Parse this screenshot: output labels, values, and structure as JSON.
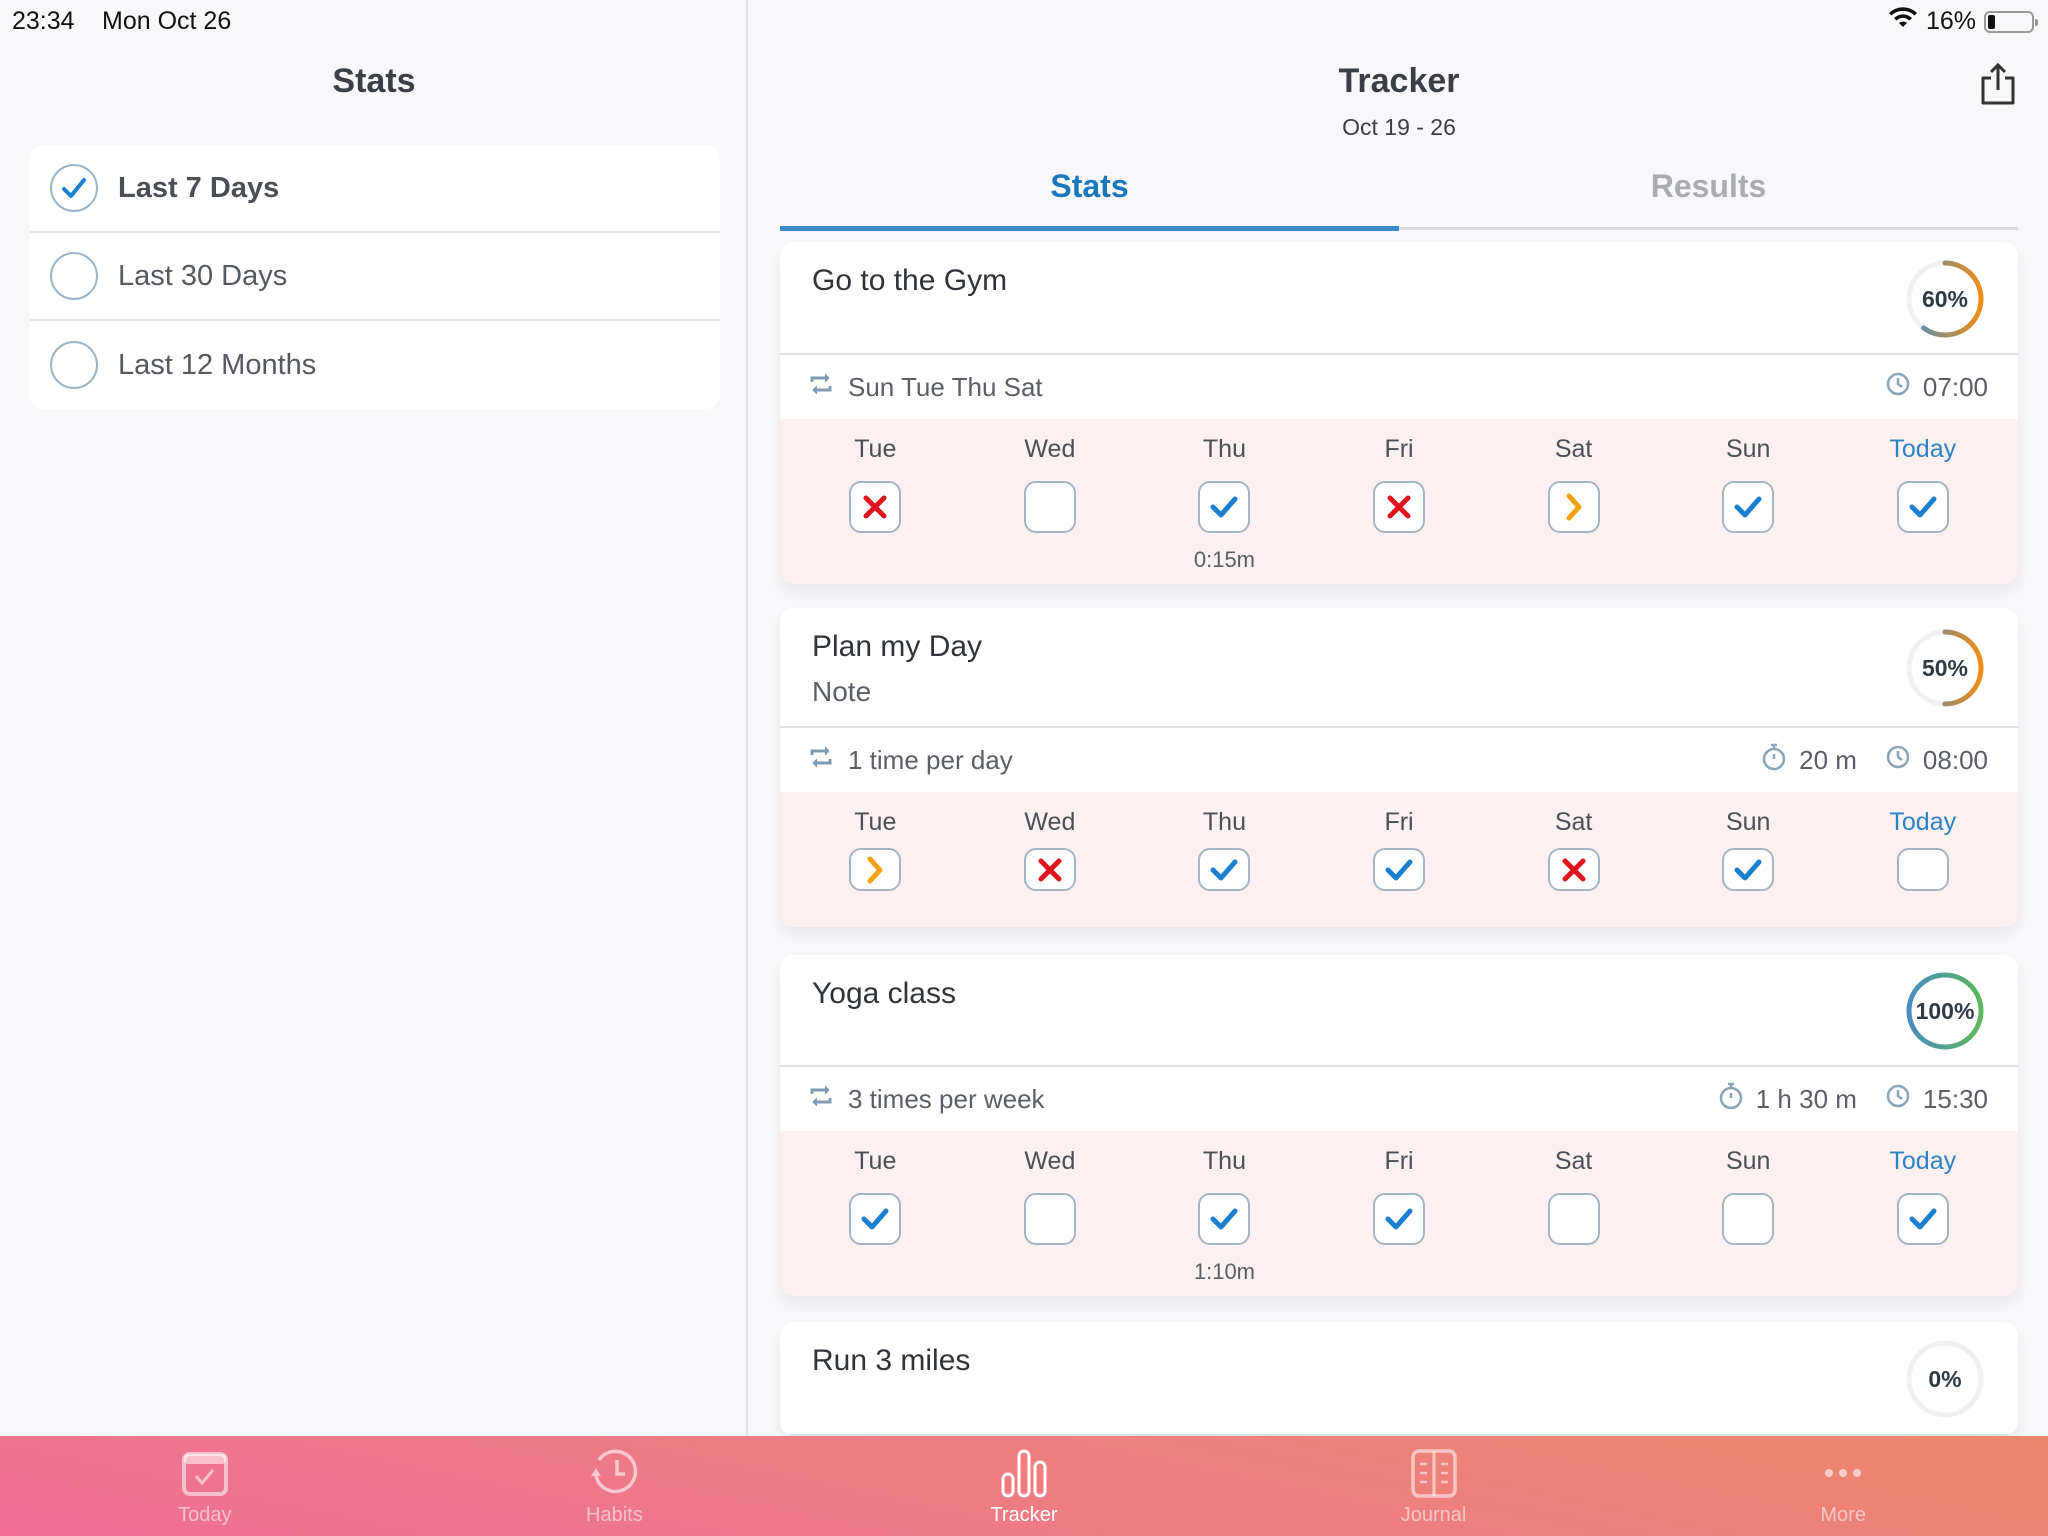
{
  "status_bar": {
    "time": "23:34",
    "date": "Mon Oct 26",
    "battery": "16%",
    "battery_level": 0.16
  },
  "left": {
    "title": "Stats",
    "ranges": [
      {
        "label": "Last 7 Days",
        "selected": true
      },
      {
        "label": "Last 30 Days",
        "selected": false
      },
      {
        "label": "Last 12 Months",
        "selected": false
      }
    ]
  },
  "right": {
    "title": "Tracker",
    "subtitle": "Oct 19 - 26",
    "tabs": [
      {
        "label": "Stats",
        "active": true
      },
      {
        "label": "Results",
        "active": false
      }
    ],
    "days": [
      "Tue",
      "Wed",
      "Thu",
      "Fri",
      "Sat",
      "Sun",
      "Today"
    ],
    "habits": [
      {
        "name": "Go to the Gym",
        "note": "",
        "percent": 60,
        "percent_label": "60%",
        "schedule": "Sun Tue Thu Sat",
        "duration": "",
        "time": "07:00",
        "states": [
          "fail",
          "empty",
          "done",
          "fail",
          "skip",
          "done",
          "done"
        ],
        "durations": [
          "",
          "",
          "0:15m",
          "",
          "",
          "",
          ""
        ]
      },
      {
        "name": "Plan my Day",
        "note": "Note",
        "percent": 50,
        "percent_label": "50%",
        "schedule": "1 time per day",
        "duration": "20 m",
        "time": "08:00",
        "states": [
          "skip",
          "fail",
          "done",
          "done",
          "fail",
          "done",
          "empty"
        ],
        "durations": [
          "",
          "",
          "",
          "",
          "",
          "",
          ""
        ]
      },
      {
        "name": "Yoga class",
        "note": "",
        "percent": 100,
        "percent_label": "100%",
        "schedule": "3 times per week",
        "duration": "1 h 30 m",
        "time": "15:30",
        "states": [
          "done",
          "empty",
          "done",
          "done",
          "empty",
          "empty",
          "done"
        ],
        "durations": [
          "",
          "",
          "1:10m",
          "",
          "",
          "",
          ""
        ]
      },
      {
        "name": "Run 3 miles",
        "note": "",
        "percent": 0,
        "percent_label": "0%"
      }
    ]
  },
  "tab_bar": [
    {
      "label": "Today",
      "icon": "calendar-check-icon",
      "active": false
    },
    {
      "label": "Habits",
      "icon": "history-clock-icon",
      "active": false
    },
    {
      "label": "Tracker",
      "icon": "bar-chart-icon",
      "active": true
    },
    {
      "label": "Journal",
      "icon": "journal-book-icon",
      "active": false
    },
    {
      "label": "More",
      "icon": "more-dots-icon",
      "active": false
    }
  ],
  "colors": {
    "accent": "#1a78bd",
    "check": "#1a7fce",
    "fail": "#e0131f",
    "skip": "#f2a20f",
    "ring_start": "#4a8cc0",
    "ring_mid_orange": "#ef8e14",
    "ring_full_green": "#5cb85c"
  }
}
